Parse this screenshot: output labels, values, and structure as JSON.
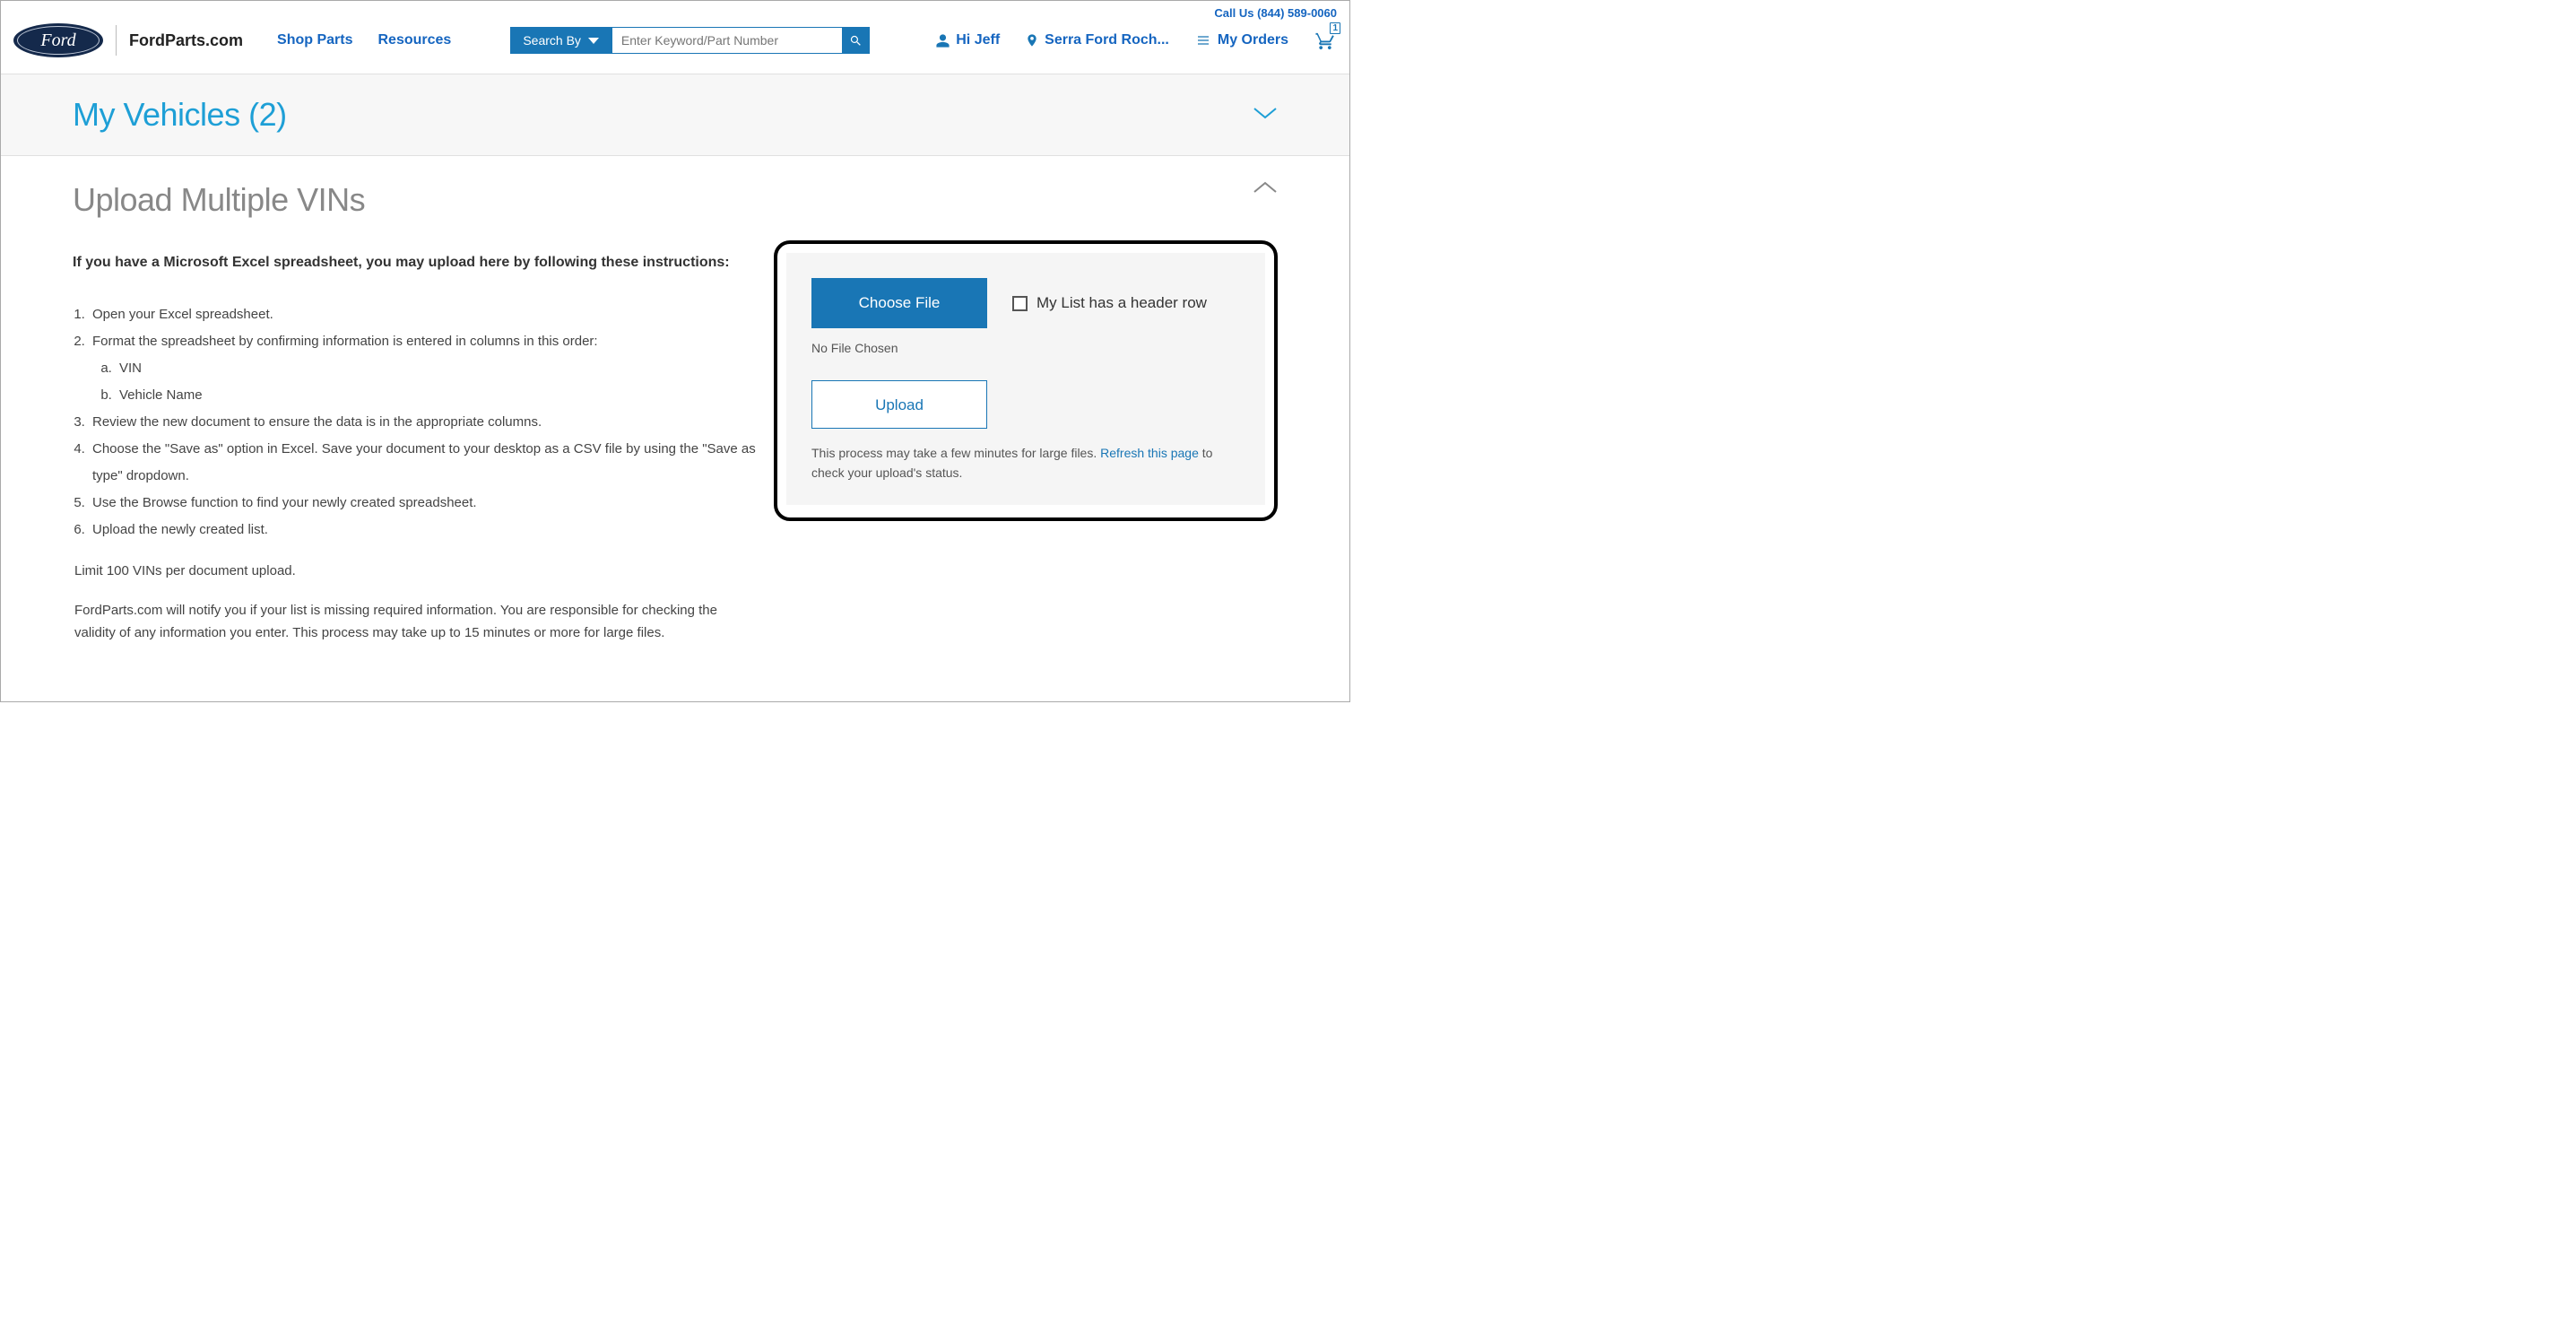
{
  "topbar": {
    "call_us": "Call Us (844) 589-0060"
  },
  "header": {
    "logo_text": "Ford",
    "brand": "FordParts.com",
    "nav": [
      "Shop Parts",
      "Resources"
    ],
    "search_by": "Search By",
    "search_placeholder": "Enter Keyword/Part Number",
    "greeting": "Hi Jeff",
    "dealer": "Serra Ford Roch...",
    "orders": "My Orders",
    "cart_badge": "1"
  },
  "band": {
    "title": "My Vehicles (2)"
  },
  "section": {
    "title": "Upload Multiple VINs",
    "intro": "If you have a Microsoft Excel spreadsheet, you may upload here by following these instructions:",
    "steps": [
      "Open your Excel spreadsheet.",
      "Format the spreadsheet by confirming information is entered in columns in this order:",
      "Review the new document to ensure the data is in the appropriate columns.",
      "Choose the \"Save as\" option in Excel. Save your document to your desktop as a CSV file by using the \"Save as type\" dropdown.",
      "Use the Browse function to find your newly created spreadsheet.",
      "Upload the newly created list."
    ],
    "substeps": [
      "VIN",
      "Vehicle Name"
    ],
    "limit": "Limit 100 VINs per document upload.",
    "note": "FordParts.com will notify you if your list is missing required information. You are responsible for checking the validity of any information you enter.  This process may take up to 15 minutes or more for large files."
  },
  "upload": {
    "choose": "Choose File",
    "checkbox": "My List has a header row",
    "no_file": "No File Chosen",
    "upload_btn": "Upload",
    "hint_prefix": "This process may take a few minutes for large files. ",
    "refresh": "Refresh this page",
    "hint_suffix": " to check your upload's status."
  }
}
